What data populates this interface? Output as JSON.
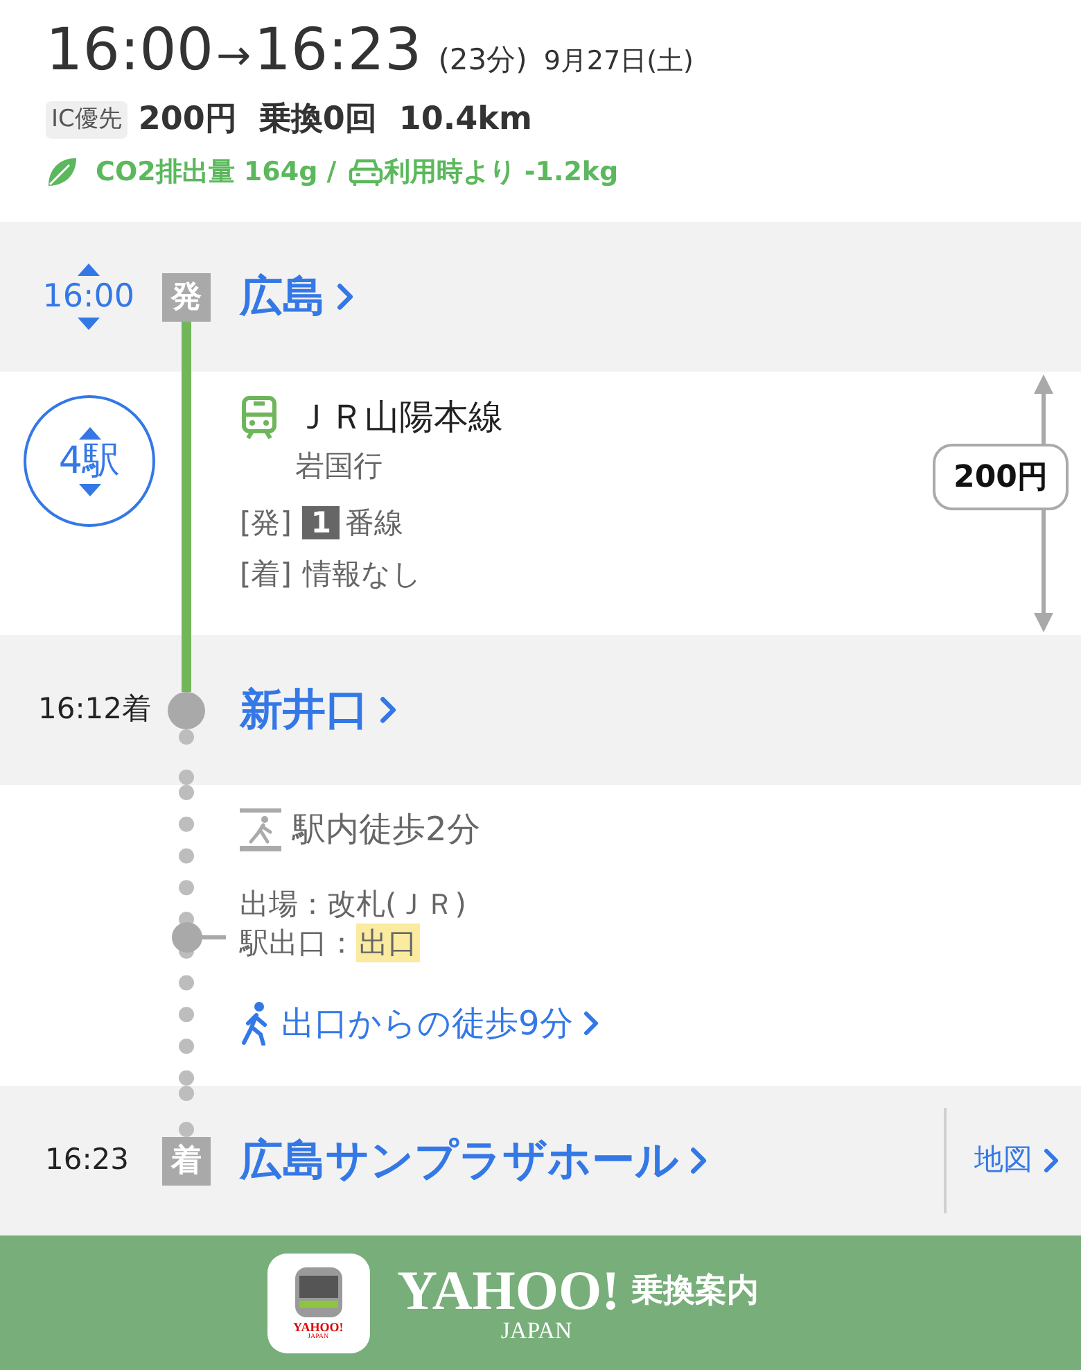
{
  "summary": {
    "depart_time": "16:00",
    "arrow": "→",
    "arrive_time": "16:23",
    "duration": "(23分)",
    "date": "9月27日(土)",
    "badge": "IC優先",
    "fare": "200円",
    "transfers": "乗換0回",
    "distance": "10.4km",
    "co2": "CO2排出量 164g /",
    "car_comparison": "利用時より -1.2kg"
  },
  "route": [
    {
      "kind": "station",
      "time": "16:00",
      "time_adjustable": true,
      "marker": "発",
      "name": "広島"
    },
    {
      "kind": "ride",
      "stops": "4駅",
      "line": "ＪＲ山陽本線",
      "direction": "岩国行",
      "departure_label": "[発]",
      "platform": "1",
      "platform_suffix": "番線",
      "arrival_label": "[着]",
      "arrival_info": "情報なし",
      "fare": "200円"
    },
    {
      "kind": "station",
      "time": "16:12着",
      "time_adjustable": false,
      "name": "新井口"
    },
    {
      "kind": "walk",
      "title": "駅内徒歩2分",
      "exit_gate": "出場：改札(ＪＲ)",
      "exit_label": "駅出口：",
      "exit_name": "出口",
      "walk_link": "出口からの徒歩9分"
    },
    {
      "kind": "station",
      "time": "16:23",
      "time_adjustable": false,
      "marker": "着",
      "name": "広島サンプラザホール",
      "map_link": "地図"
    }
  ],
  "footer": {
    "brand": "YAHOO!",
    "brand_sub": "JAPAN",
    "service": "乗換案内",
    "app_icon_brand": "YAHOO!",
    "app_icon_sub": "JAPAN"
  }
}
